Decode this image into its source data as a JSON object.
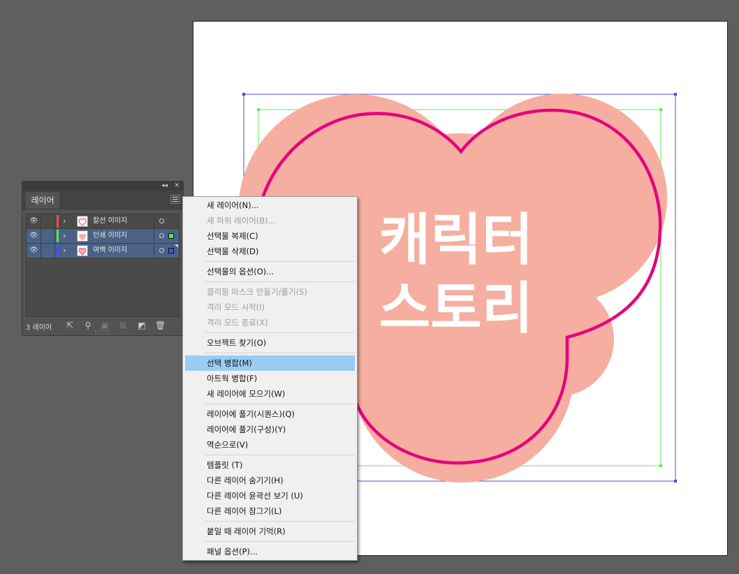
{
  "artboard": {
    "artwork_text_line1": "캐릭터",
    "artwork_text_line2": "스토리"
  },
  "layers_panel": {
    "tab_label": "레이어",
    "collapse_glyph": "◂◂",
    "close_glyph": "✕",
    "layers": [
      {
        "name": "칼선 이미지",
        "color": "#ff4a4a",
        "selected": false,
        "thumb_icon": "heart-outline-icon"
      },
      {
        "name": "인쇄 이미지",
        "color": "#4af04a",
        "selected": true,
        "thumb_icon": "character-print-icon"
      },
      {
        "name": "여백 이미지",
        "color": "#4a4aff",
        "selected": true,
        "thumb_icon": "heart-margin-icon"
      }
    ],
    "footer": {
      "layer_count": "3 레이어"
    }
  },
  "context_menu": {
    "items": [
      {
        "label": "새 레이어(N)...",
        "disabled": false
      },
      {
        "label": "새 하위 레이어(B)...",
        "disabled": true
      },
      {
        "label": "선택물 복제(C)",
        "disabled": false
      },
      {
        "label": "선택물 삭제(D)",
        "disabled": false
      },
      {
        "label": "선택물의 옵션(O)...",
        "disabled": false
      },
      {
        "label": "클리핑 마스크 만들기/풀기(S)",
        "disabled": true
      },
      {
        "label": "격리 모드 시작(I)",
        "disabled": true
      },
      {
        "label": "격리 모드 종료(X)",
        "disabled": true
      },
      {
        "label": "오브젝트 찾기(O)",
        "disabled": false
      },
      {
        "label": "선택 병합(M)",
        "disabled": false,
        "highlighted": true
      },
      {
        "label": "아트웍 병합(F)",
        "disabled": false
      },
      {
        "label": "새 레이어에 모으기(W)",
        "disabled": false
      },
      {
        "label": "레이어에 풀기(시퀀스)(Q)",
        "disabled": false
      },
      {
        "label": "레이어에 풀기(구성)(Y)",
        "disabled": false
      },
      {
        "label": "역순으로(V)",
        "disabled": false
      },
      {
        "label": "템플릿 (T)",
        "disabled": false
      },
      {
        "label": "다른 레이어 숨기기(H)",
        "disabled": false
      },
      {
        "label": "다른 레이어 윤곽선 보기 (U)",
        "disabled": false
      },
      {
        "label": "다른 레이어 잠그기(L)",
        "disabled": false
      },
      {
        "label": "붙일 때 레이어 기억(R)",
        "disabled": false
      },
      {
        "label": "패널 옵션(P)...",
        "disabled": false
      }
    ],
    "highlight_color": "#99ccf5"
  },
  "colors": {
    "canvas_bg": "#5f5f5f",
    "artwork_fill": "#f5ae9f",
    "cut_line": "#e5007f",
    "bbox_blue": "#4b4bdc",
    "bbox_green": "#5ce65c"
  }
}
